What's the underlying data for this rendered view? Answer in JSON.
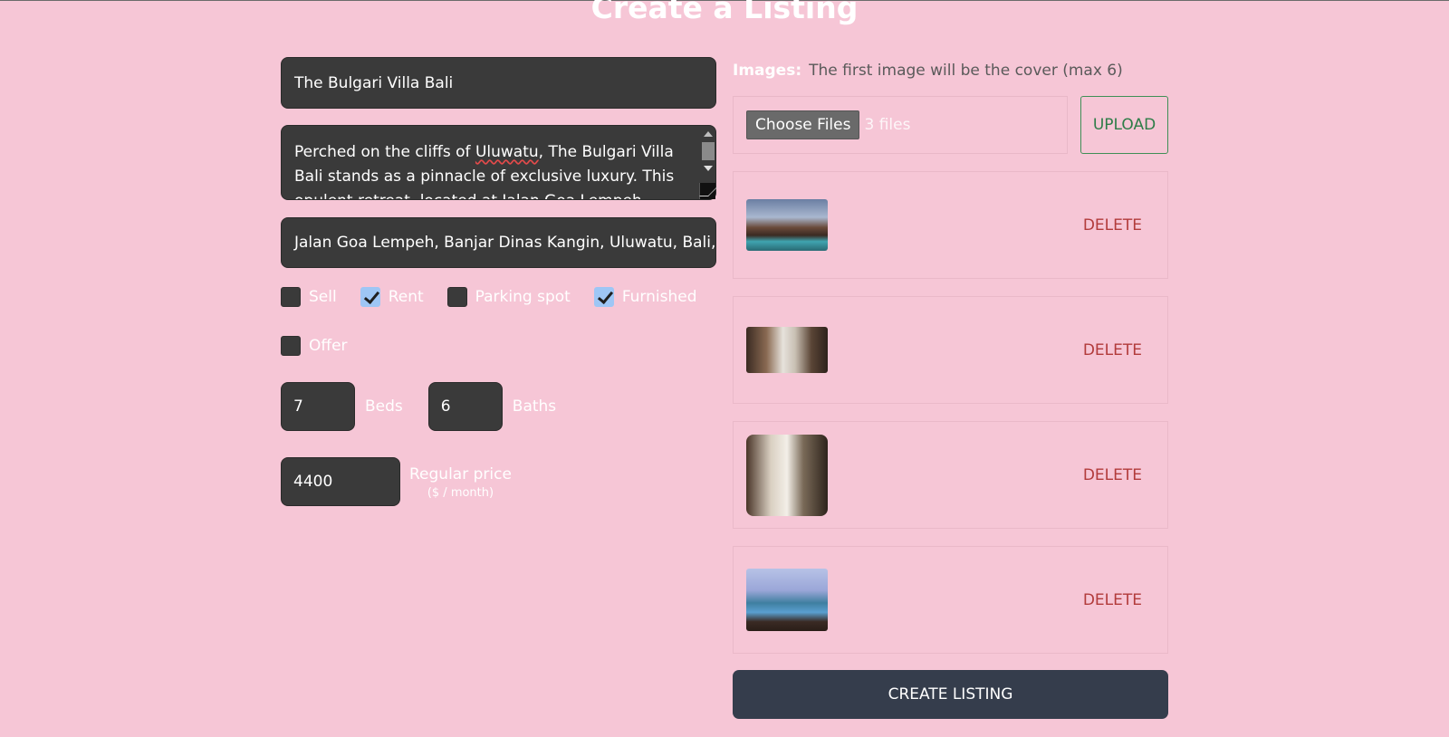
{
  "page": {
    "title": "Create a Listing"
  },
  "form": {
    "name": "The Bulgari Villa Bali",
    "description_before": "Perched on the cliffs of ",
    "description_misspelled": "Uluwatu",
    "description_after": ", The Bulgari Villa Bali stands as a pinnacle of exclusive luxury. This opulent retreat, located at Jalan Goa Lempeh, Banjar Dinas",
    "address": "Jalan Goa Lempeh, Banjar Dinas Kangin, Uluwatu, Bali, Inc",
    "checkboxes": [
      {
        "label": "Sell",
        "checked": false
      },
      {
        "label": "Rent",
        "checked": true
      },
      {
        "label": "Parking spot",
        "checked": false
      },
      {
        "label": "Furnished",
        "checked": true
      },
      {
        "label": "Offer",
        "checked": false
      }
    ],
    "beds": {
      "value": "7",
      "label": "Beds"
    },
    "baths": {
      "value": "6",
      "label": "Baths"
    },
    "price": {
      "value": "4400",
      "label": "Regular price",
      "unit": "($ / month)"
    }
  },
  "images": {
    "label": "Images:",
    "hint": "The first image will be the cover (max 6)",
    "choose_label": "Choose Files",
    "file_count": "3 files",
    "upload_label": "UPLOAD",
    "items": [
      {
        "thumb": "villa-pool-exterior",
        "delete_label": "DELETE"
      },
      {
        "thumb": "bedroom-interior",
        "delete_label": "DELETE"
      },
      {
        "thumb": "bedroom-ocean-view",
        "delete_label": "DELETE"
      },
      {
        "thumb": "infinity-pool-sunset",
        "delete_label": "DELETE"
      }
    ]
  },
  "submit": {
    "label": "CREATE LISTING"
  },
  "colors": {
    "background": "#f6c6d6",
    "field": "#3a3a3a",
    "submit": "#353d4c",
    "delete": "#b23b3b",
    "upload": "#2e7d48"
  }
}
